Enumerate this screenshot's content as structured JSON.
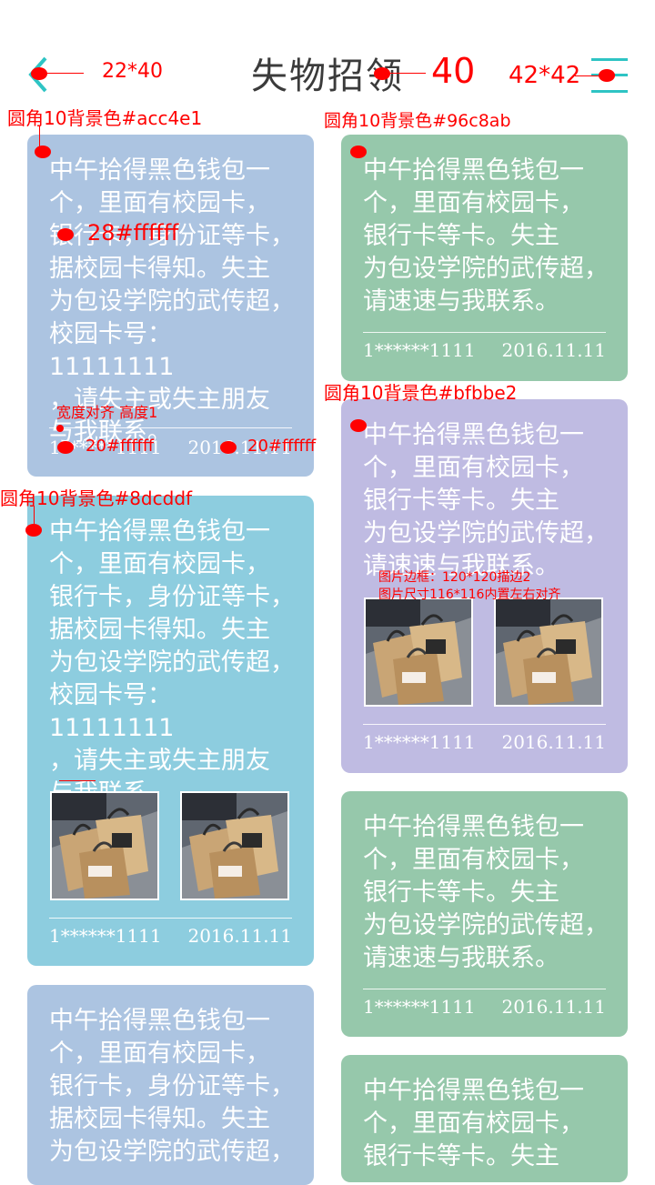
{
  "header": {
    "title": "失物招领",
    "back_icon": "chevron-left-icon",
    "menu_icon": "menu-icon",
    "accent_color": "#2ec4c4"
  },
  "cards": [
    {
      "color": "#acc4e1",
      "text": "中午拾得黑色钱包一\n个，里面有校园卡，\n银行卡，身份证等卡，\n据校园卡得知。失主\n为包设学院的武传超，\n校园卡号：11111111\n，请失主或失主朋友\n与我联系。",
      "user": "1******1111",
      "date": "2016.11.11"
    },
    {
      "color": "#96c8ab",
      "text": "中午拾得黑色钱包一\n个，里面有校园卡，\n银行卡等卡。失主\n为包设学院的武传超，\n请速速与我联系。",
      "user": "1******1111",
      "date": "2016.11.11"
    },
    {
      "color": "#bfbbe2",
      "text": "中午拾得黑色钱包一\n个，里面有校园卡，\n银行卡等卡。失主\n为包设学院的武传超，\n请速速与我联系。",
      "user": "1******1111",
      "date": "2016.11.11"
    },
    {
      "color": "#8dcddf",
      "text": "中午拾得黑色钱包一\n个，里面有校园卡，\n银行卡，身份证等卡，\n据校园卡得知。失主\n为包设学院的武传超，\n校园卡号：11111111\n，请失主或失主朋友\n与我联系。",
      "user": "1******1111",
      "date": "2016.11.11"
    },
    {
      "color": "#96c8ab",
      "text": "中午拾得黑色钱包一\n个，里面有校园卡，\n银行卡等卡。失主\n为包设学院的武传超，\n请速速与我联系。",
      "user": "1******1111",
      "date": "2016.11.11"
    },
    {
      "color": "#acc4e1",
      "text": "中午拾得黑色钱包一\n个，里面有校园卡，\n银行卡，身份证等卡，\n据校园卡得知。失主\n为包设学院的武传超，",
      "user": "",
      "date": ""
    },
    {
      "color": "#96c8ab",
      "text": "中午拾得黑色钱包一\n个，里面有校园卡，\n银行卡等卡。失主",
      "user": "",
      "date": ""
    }
  ],
  "annotations": {
    "back_size": "22*40",
    "title_size": "40",
    "menu_size": "42*42",
    "card1_bg": "圆角10背景色#acc4e1",
    "card2_bg": "圆角10背景色#96c8ab",
    "card3_bg": "圆角10背景色#bfbbe2",
    "card4_bg": "圆角10背景色#8dcddf",
    "text_spec": "28#ffffff",
    "divider_spec": "宽度对齐 高度1",
    "footer_left_spec": "20#ffffff",
    "footer_right_spec": "20#ffffff",
    "photo_border_spec": "图片边框：120*120描边2",
    "photo_size_spec": "图片尺寸116*116内置左右对齐"
  }
}
